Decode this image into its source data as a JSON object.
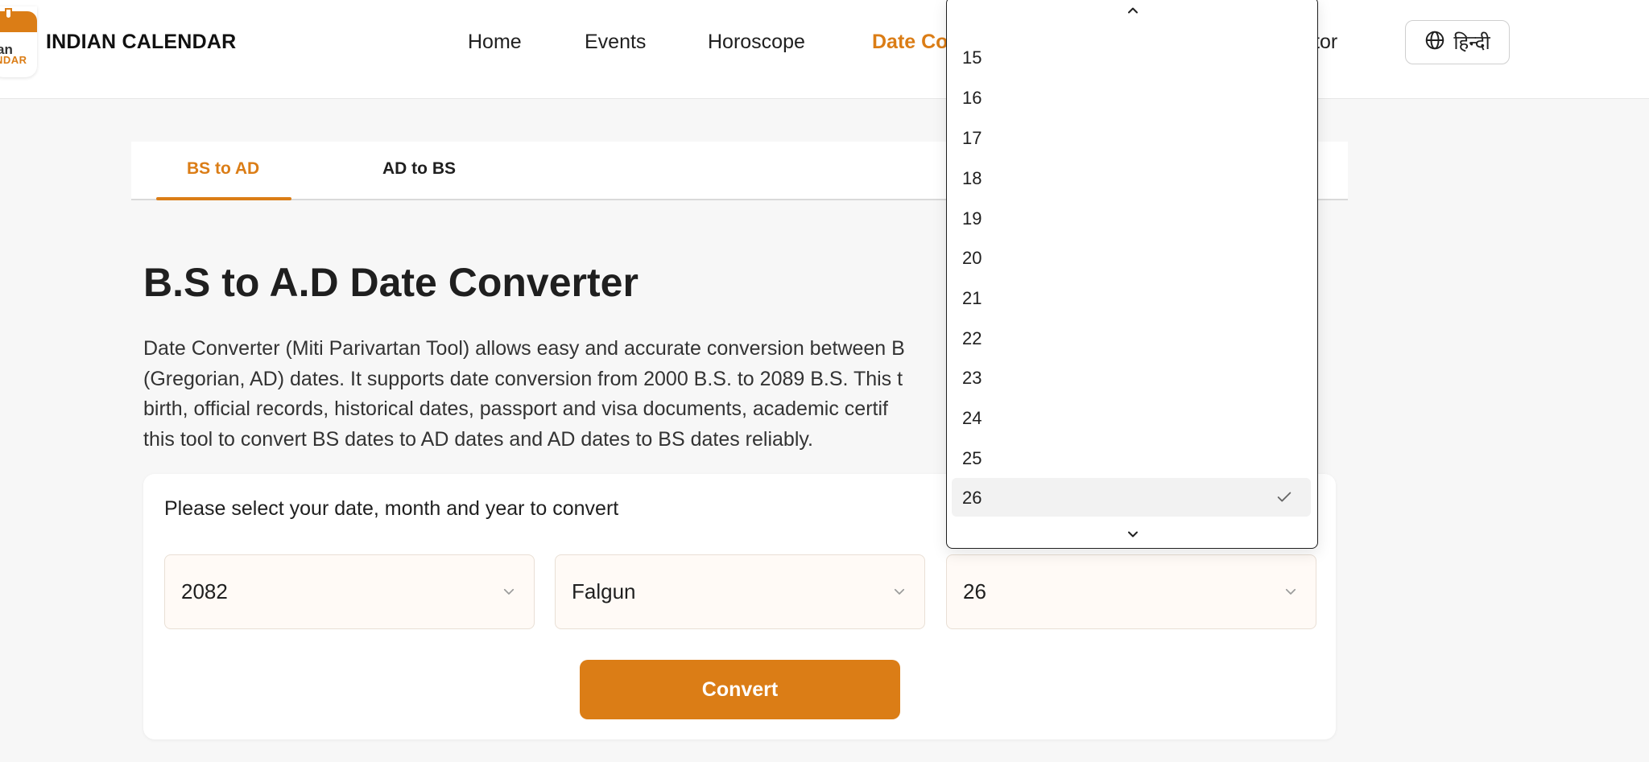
{
  "header": {
    "brand": "INDIAN CALENDAR",
    "logo_top": "an",
    "logo_bottom": "NDAR",
    "nav": [
      {
        "label": "Home"
      },
      {
        "label": "Events"
      },
      {
        "label": "Horoscope"
      },
      {
        "label": "Date Co"
      },
      {
        "label": "tor"
      }
    ],
    "language_label": "हिन्दी"
  },
  "tabs": [
    {
      "label": "BS to AD",
      "active": true
    },
    {
      "label": "AD to BS",
      "active": false
    }
  ],
  "main": {
    "title": "B.S to A.D Date Converter",
    "description_lines": [
      "Date Converter (Miti Parivartan Tool) allows easy and accurate conversion between B",
      "(Gregorian, AD) dates. It supports date conversion from 2000 B.S. to 2089 B.S. This t",
      "birth, official records, historical dates, passport and visa documents, academic certif",
      "this tool to convert BS dates to AD dates and AD dates to BS dates reliably."
    ],
    "form_label": "Please select your date, month and year to convert",
    "year_value": "2082",
    "month_value": "Falgun",
    "day_value": "26",
    "convert_label": "Convert"
  },
  "dropdown": {
    "options": [
      "15",
      "16",
      "17",
      "18",
      "19",
      "20",
      "21",
      "22",
      "23",
      "24",
      "25",
      "26"
    ],
    "selected": "26"
  },
  "colors": {
    "accent": "#db7d16",
    "text": "#1f1f1f",
    "background": "#f7f7f7"
  },
  "icons": [
    "globe-icon",
    "chevron-down-icon",
    "chevron-up-icon",
    "check-icon"
  ]
}
